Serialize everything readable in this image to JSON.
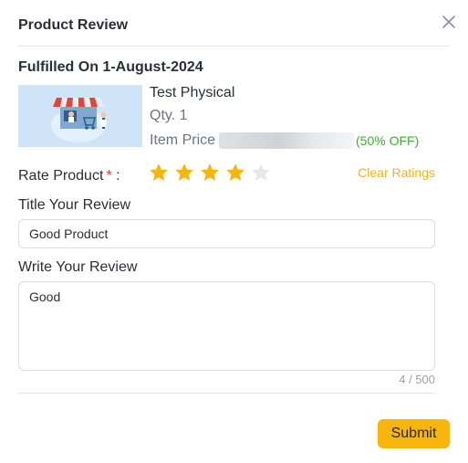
{
  "header": {
    "title": "Product Review",
    "close_icon": "close-icon"
  },
  "order": {
    "fulfilled_text": "Fulfilled On 1-August-2024"
  },
  "product": {
    "thumbnail_icon": "shop-cart-illustration",
    "name": "Test Physical",
    "qty_label": "Qty.",
    "qty_value": "1",
    "price_label": "Item Price",
    "discount": "(50% OFF)"
  },
  "rating": {
    "label": "Rate Product",
    "required_mark": "*",
    "colon": ":",
    "value": 4,
    "max": 5,
    "filled_color": "#f8b50b",
    "empty_color": "#e6e7ea",
    "clear_label": "Clear Ratings"
  },
  "title_field": {
    "label": "Title Your Review",
    "value": "Good Product"
  },
  "review_field": {
    "label": "Write Your Review",
    "value": "Good",
    "char_count": "4 / 500"
  },
  "footer": {
    "submit_label": "Submit"
  },
  "colors": {
    "accent": "#f8b50b",
    "discount": "#3eaf2e",
    "required": "#e8413c"
  }
}
